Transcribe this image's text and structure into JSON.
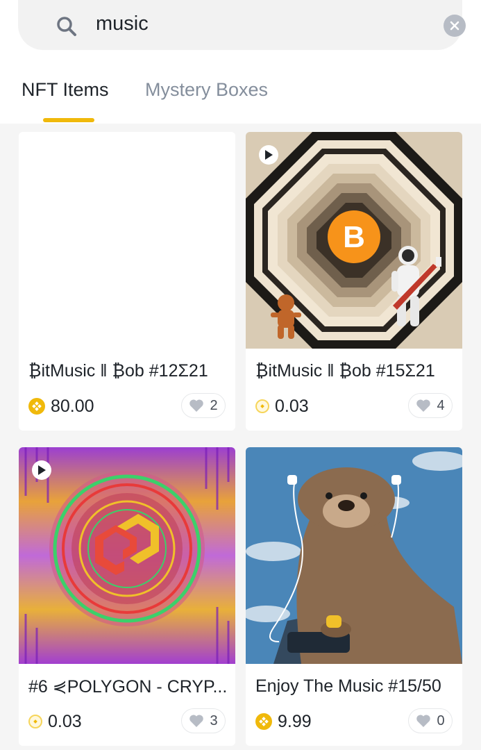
{
  "search": {
    "value": "music"
  },
  "tabs": [
    {
      "label": "NFT Items",
      "active": true
    },
    {
      "label": "Mystery Boxes",
      "active": false
    }
  ],
  "accent_color": "#F0B90B",
  "cards": [
    {
      "title": "₿itMusic ‖ ₿ob #12Σ21",
      "price": "80.00",
      "coin_icon": "bnb-coin-icon",
      "likes": "2",
      "has_play": false
    },
    {
      "title": "₿itMusic ‖ ₿ob #15Σ21",
      "price": "0.03",
      "coin_icon": "small-coin-icon",
      "likes": "4",
      "has_play": true
    },
    {
      "title": "#6 ⋞POLYGON - CRYP...",
      "price": "0.03",
      "coin_icon": "small-coin-icon",
      "likes": "3",
      "has_play": true
    },
    {
      "title": "Enjoy The Music #15/50",
      "price": "9.99",
      "coin_icon": "bnb-coin-icon",
      "likes": "0",
      "has_play": false
    }
  ]
}
